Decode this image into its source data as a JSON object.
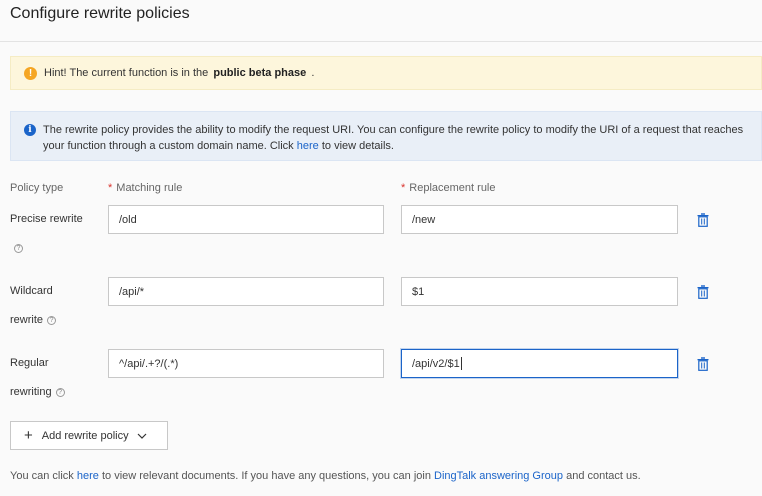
{
  "page": {
    "title": "Configure rewrite policies"
  },
  "hint": {
    "icon": "exclamation-icon",
    "prefix": "Hint! The current function is in the",
    "emphasis": "public beta phase",
    "suffix": "."
  },
  "info": {
    "icon": "info-icon",
    "text_before": "The rewrite policy provides the ability to modify the request URI. You can configure the rewrite policy to modify the URI of a request that reaches your function through a custom domain name. Click",
    "link": "here",
    "text_after": "to view details."
  },
  "columns": {
    "policy_type": "Policy type",
    "matching_required": "*",
    "matching_rule": "Matching rule",
    "replacement_required": "*",
    "replacement_rule": "Replacement rule"
  },
  "rules": [
    {
      "type_label": "Precise rewrite",
      "matching": "/old",
      "replacement": "/new"
    },
    {
      "type_label_1": "Wildcard",
      "type_label_2": "rewrite",
      "matching": "/api/*",
      "replacement": "$1"
    },
    {
      "type_label_1": "Regular",
      "type_label_2": "rewriting",
      "matching": "^/api/.+?/(.*)",
      "replacement": "/api/v2/$1"
    }
  ],
  "help_glyph": "?",
  "add_button": {
    "label": "Add rewrite policy",
    "plus": "+",
    "icon": "chevron-down-icon"
  },
  "footer": {
    "before": "You can click",
    "link1": "here",
    "middle": "to view relevant documents. If you have any questions, you can join",
    "link2": "DingTalk answering Group",
    "after": "and contact us."
  },
  "colors": {
    "accent": "#1b64c9",
    "warning": "#f5a623",
    "required": "#d9322c",
    "hint_bg": "#fdf6dc",
    "info_bg": "#e9eff7"
  }
}
